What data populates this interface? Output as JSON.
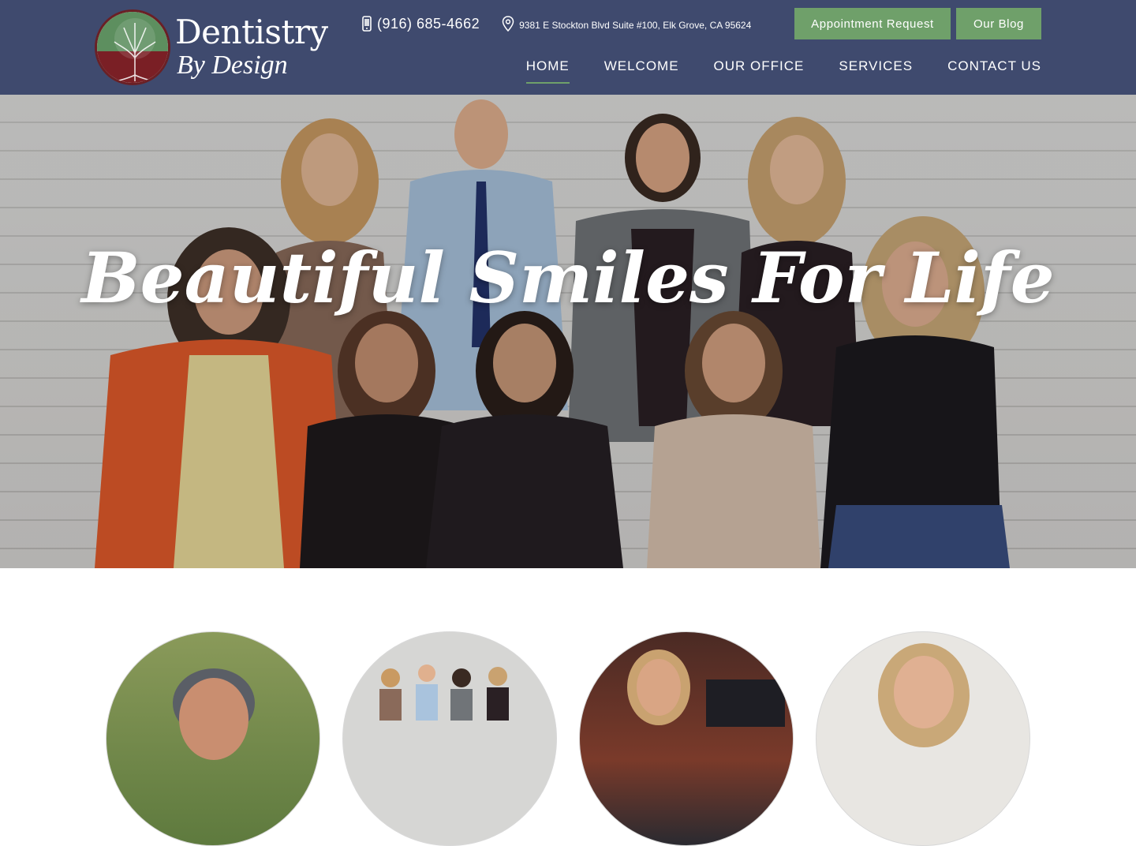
{
  "brand": {
    "name": "Dentistry",
    "tagline": "By Design"
  },
  "contact": {
    "phone": "(916) 685-4662",
    "address": "9381 E Stockton Blvd Suite #100, Elk Grove, CA 95624"
  },
  "buttons": {
    "appointment": "Appointment Request",
    "blog": "Our Blog"
  },
  "nav": {
    "items": [
      "HOME",
      "WELCOME",
      "OUR OFFICE",
      "SERVICES",
      "CONTACT US"
    ],
    "active": "HOME"
  },
  "hero": {
    "title": "Beautiful Smiles For Life"
  },
  "colors": {
    "header": "#3f4a6e",
    "accent": "#6fa06a",
    "text_light": "#ffffff"
  }
}
